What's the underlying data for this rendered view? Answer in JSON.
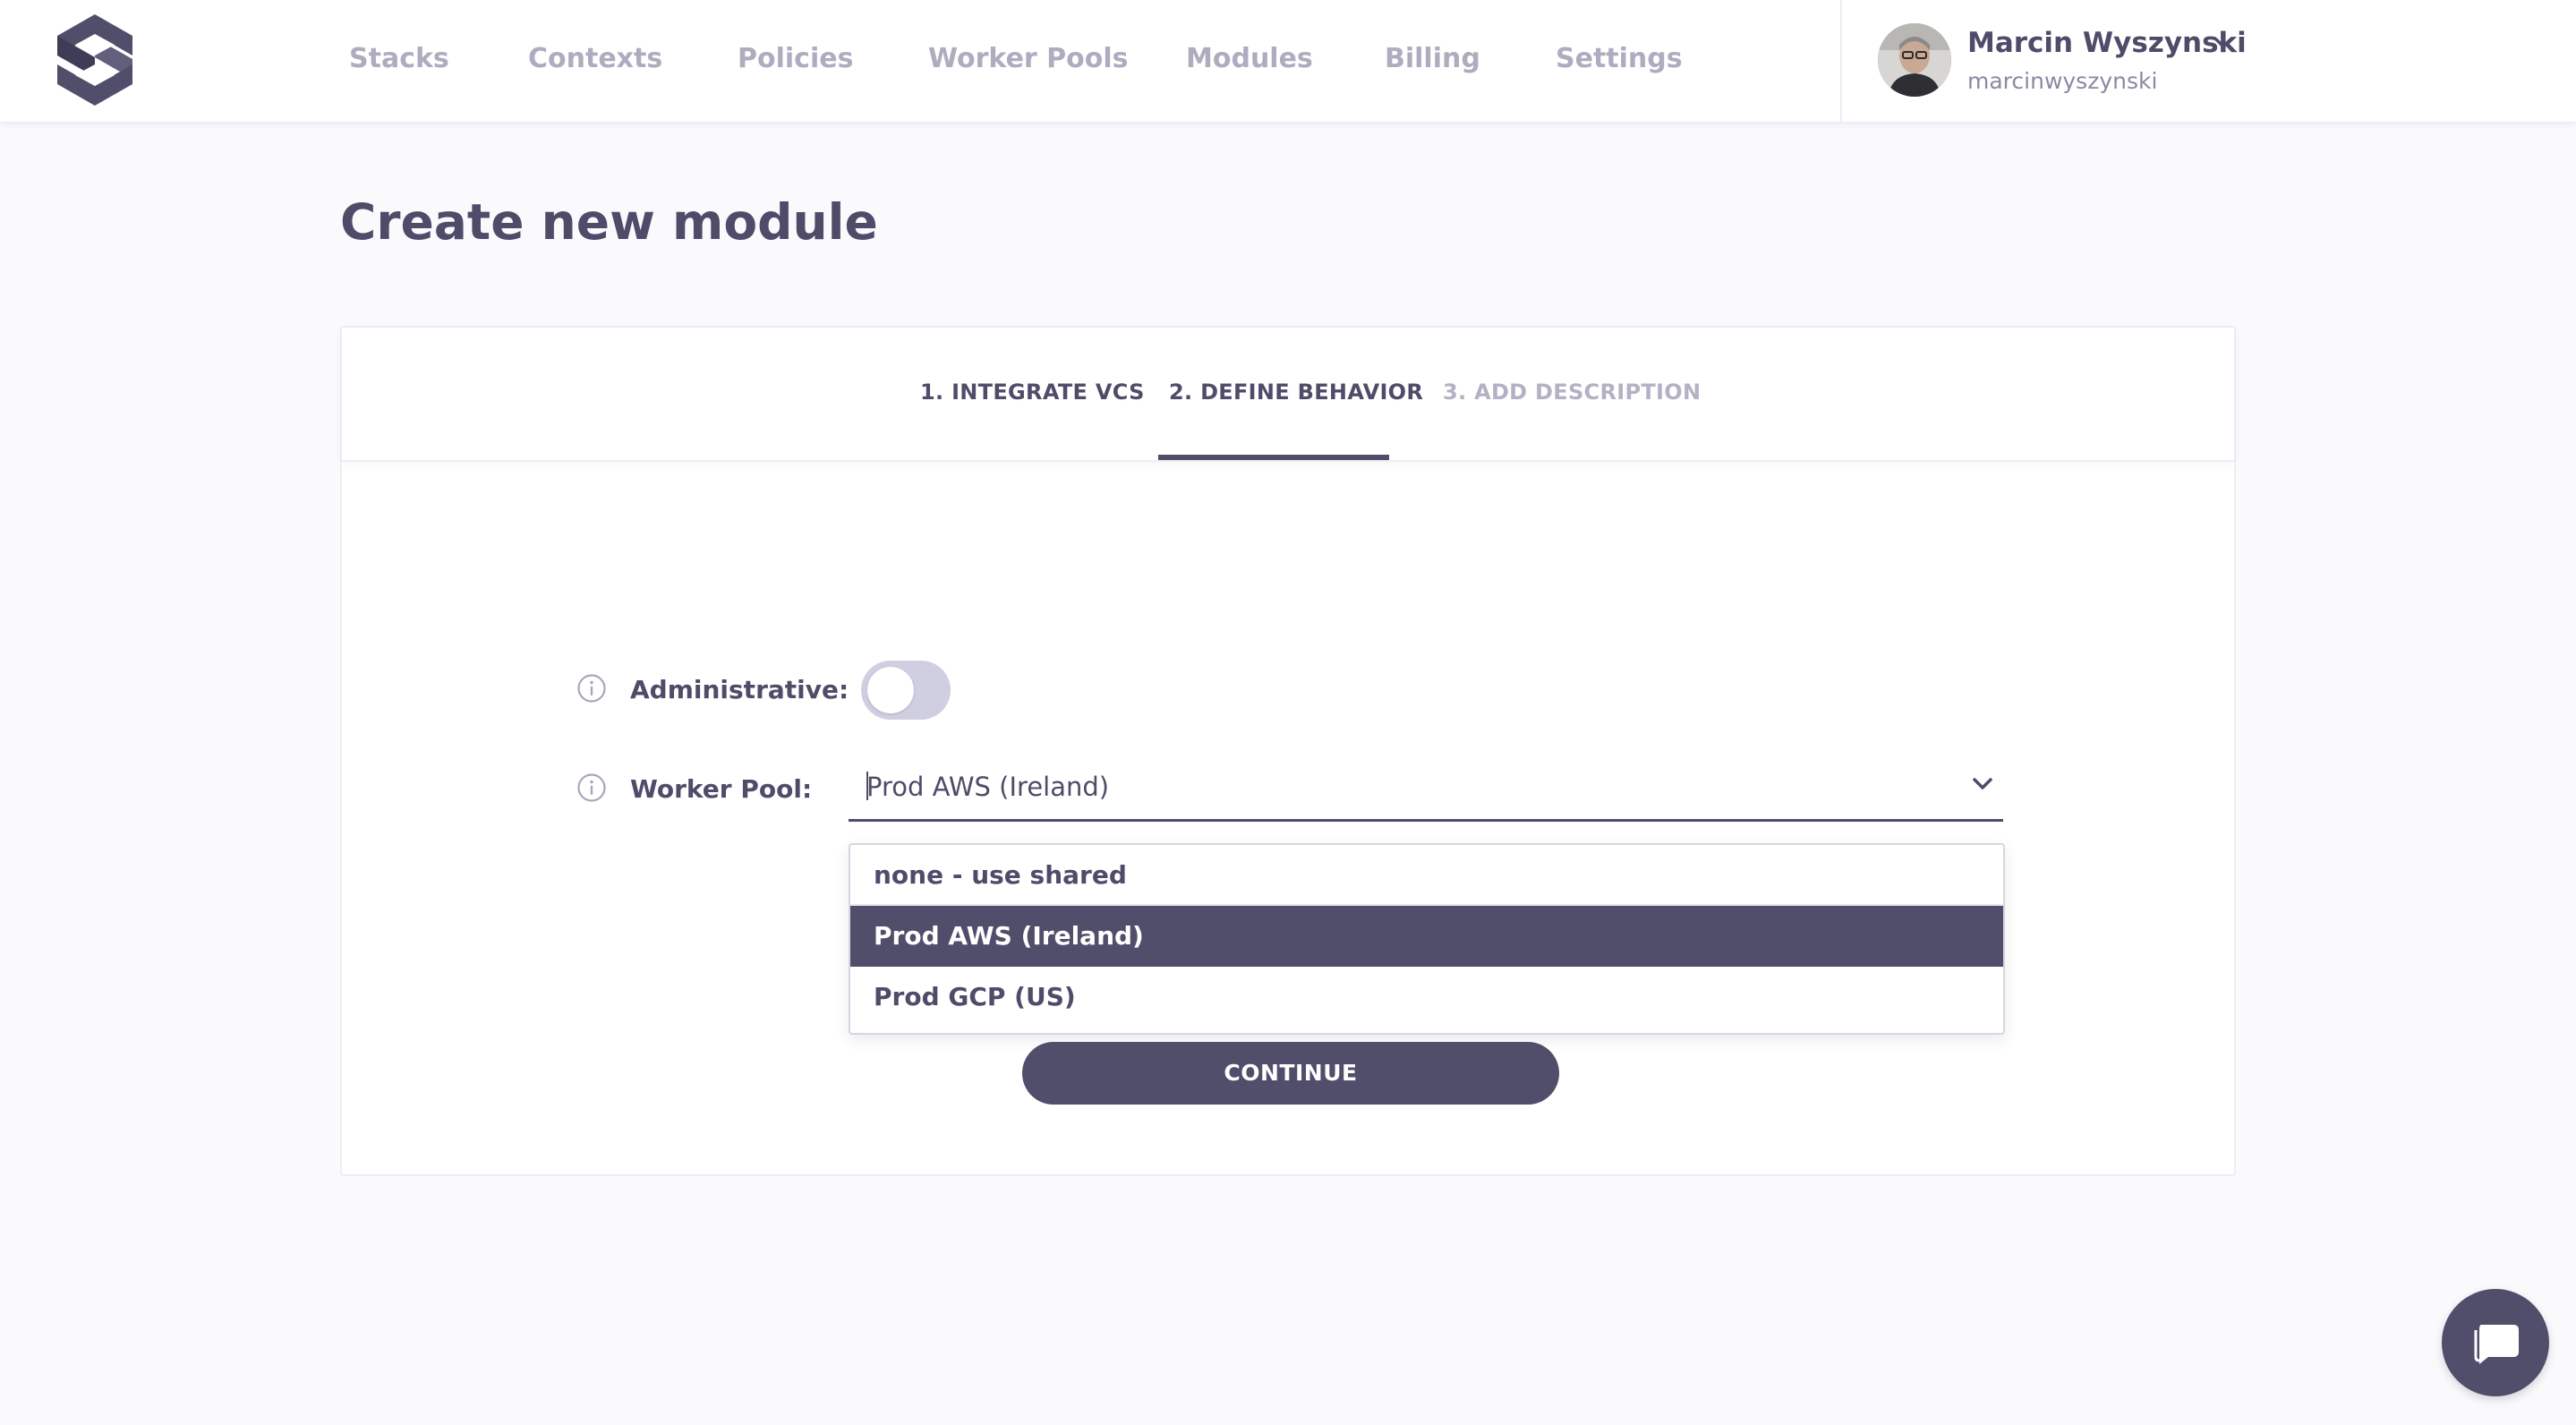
{
  "nav": {
    "items": [
      {
        "label": "Stacks"
      },
      {
        "label": "Contexts"
      },
      {
        "label": "Policies"
      },
      {
        "label": "Worker Pools"
      },
      {
        "label": "Modules"
      },
      {
        "label": "Billing"
      },
      {
        "label": "Settings"
      }
    ]
  },
  "user": {
    "name": "Marcin Wyszynski",
    "handle": "marcinwyszynski"
  },
  "page": {
    "title": "Create new module"
  },
  "wizard": {
    "tabs": [
      {
        "label": "1. INTEGRATE VCS",
        "state": "done"
      },
      {
        "label": "2. DEFINE BEHAVIOR",
        "state": "active"
      },
      {
        "label": "3. ADD DESCRIPTION",
        "state": "upcoming"
      }
    ]
  },
  "form": {
    "administrative": {
      "label": "Administrative:",
      "enabled": false
    },
    "worker_pool": {
      "label": "Worker Pool:",
      "value": "Prod AWS (Ireland)",
      "options": [
        "none - use shared",
        "Prod AWS (Ireland)",
        "Prod GCP (US)"
      ],
      "selected": "Prod AWS (Ireland)"
    },
    "continue_label": "CONTINUE"
  },
  "colors": {
    "primary": "#514e6b",
    "text": "#4f4c69",
    "muted": "#aeacbf",
    "background": "#fafafd"
  }
}
